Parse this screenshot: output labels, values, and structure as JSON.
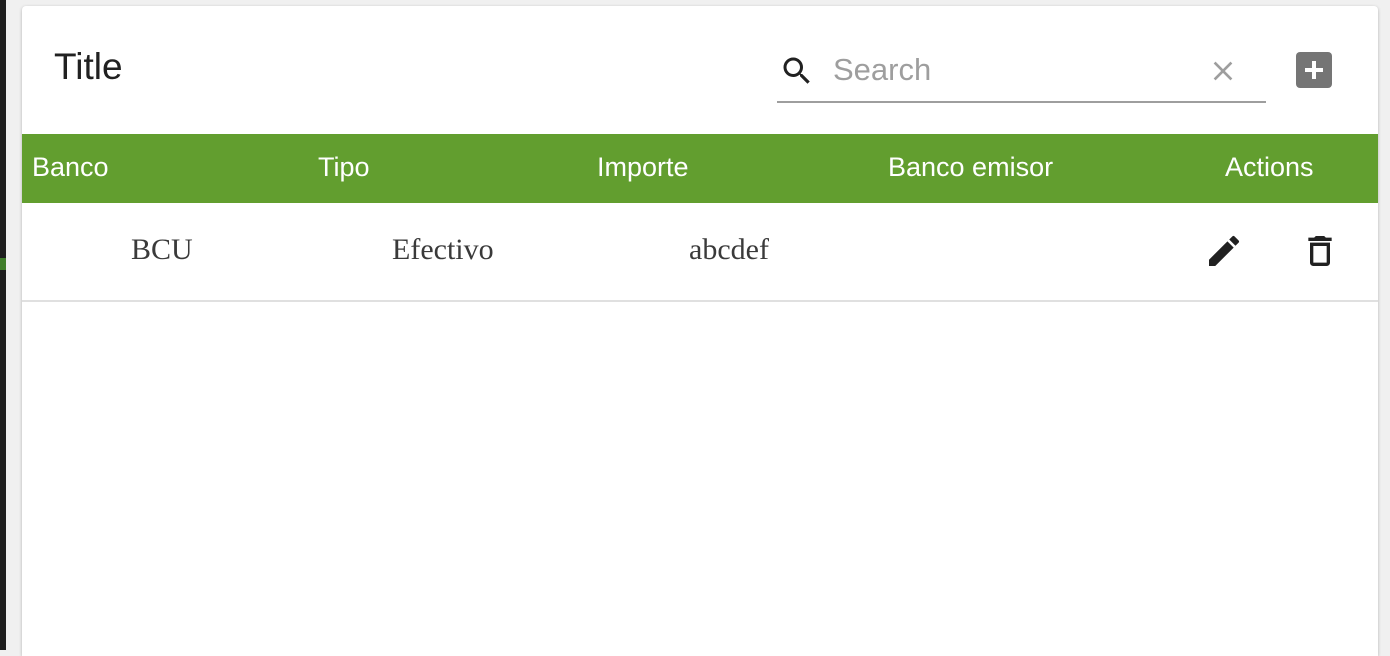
{
  "toolbar": {
    "title": "Title",
    "search": {
      "placeholder": "Search",
      "value": ""
    },
    "icons": {
      "search": "search-icon",
      "clear": "close-icon",
      "add": "add-box-icon"
    }
  },
  "table": {
    "columns": [
      "Banco",
      "Tipo",
      "Importe",
      "Banco emisor",
      "Actions"
    ],
    "rows": [
      {
        "banco": "BCU",
        "tipo": "Efectivo",
        "importe": "abcdef",
        "banco_emisor": "",
        "actions": [
          "edit-icon",
          "delete-icon"
        ]
      }
    ]
  },
  "colors": {
    "header_bg": "#629e2f",
    "header_text": "#ffffff",
    "add_button": "#757575"
  }
}
